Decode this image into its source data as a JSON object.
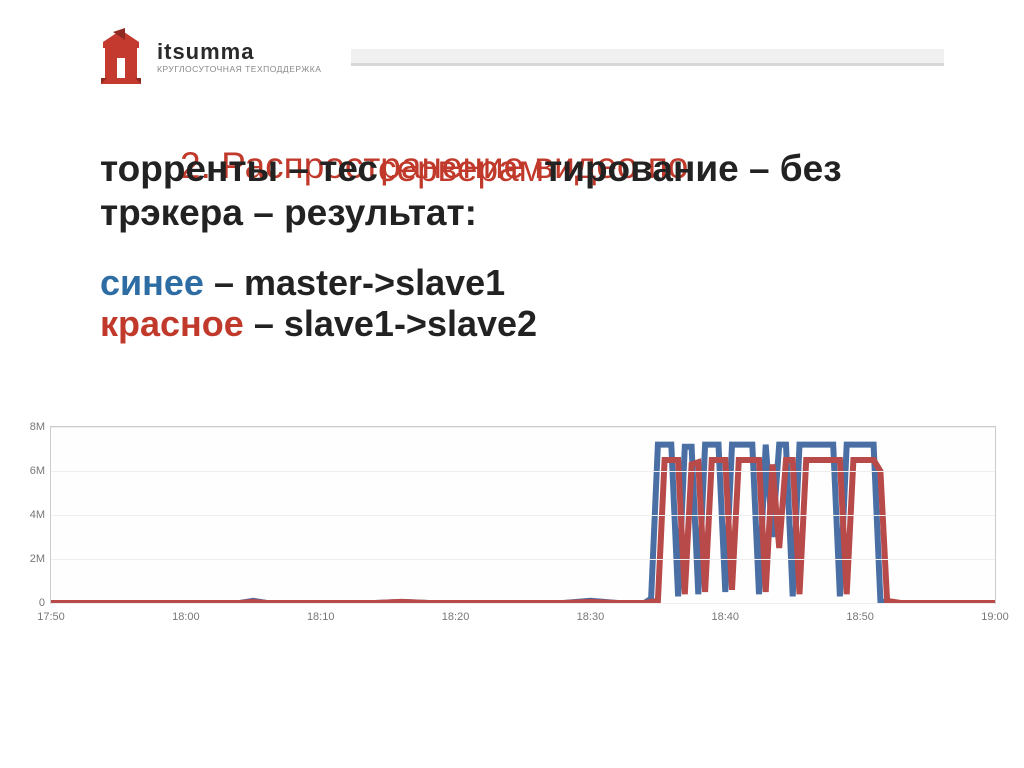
{
  "logo": {
    "brand": "itsumma",
    "sub": "КРУГЛОСУТОЧНАЯ ТЕХПОДДЕРЖКА"
  },
  "title_line1": "2. Распространение видео по",
  "title_mix_pre": "торренты – тес",
  "title_mix_red": "серверам",
  "title_mix_post": "тирование – без",
  "title_line2": "трэкера – результат:",
  "legend": {
    "blue_label": "синее",
    "blue_desc": " – master->slave1",
    "red_label": "красное",
    "red_desc": " – slave1->slave2"
  },
  "chart_data": {
    "type": "line",
    "title": "",
    "xlabel": "",
    "ylabel": "",
    "xlim": [
      "17:50",
      "19:00"
    ],
    "ylim": [
      0,
      8
    ],
    "y_unit": "M",
    "y_ticks": [
      0,
      2,
      4,
      6,
      8
    ],
    "y_tick_labels": [
      "0",
      "2M",
      "4M",
      "6M",
      "8M"
    ],
    "categories": [
      "17:50",
      "18:00",
      "18:10",
      "18:20",
      "18:30",
      "18:40",
      "18:50",
      "19:00"
    ],
    "x_minutes": [
      0,
      10,
      20,
      30,
      40,
      50,
      60,
      70
    ],
    "series": [
      {
        "name": "master->slave1",
        "color": "#4a6fa5",
        "points": [
          [
            0,
            0.0
          ],
          [
            1,
            0.0
          ],
          [
            2,
            0.0
          ],
          [
            3,
            0.0
          ],
          [
            4,
            0.0
          ],
          [
            5,
            0.0
          ],
          [
            6,
            0.0
          ],
          [
            7,
            0.0
          ],
          [
            8,
            0.0
          ],
          [
            9,
            0.0
          ],
          [
            10,
            0.0
          ],
          [
            12,
            0.0
          ],
          [
            14,
            0.0
          ],
          [
            15,
            0.1
          ],
          [
            16,
            0.0
          ],
          [
            18,
            0.0
          ],
          [
            20,
            0.0
          ],
          [
            22,
            0.0
          ],
          [
            24,
            0.0
          ],
          [
            26,
            0.05
          ],
          [
            28,
            0.0
          ],
          [
            30,
            0.0
          ],
          [
            32,
            0.0
          ],
          [
            34,
            0.0
          ],
          [
            36,
            0.0
          ],
          [
            38,
            0.0
          ],
          [
            40,
            0.1
          ],
          [
            42,
            0.0
          ],
          [
            43,
            0.0
          ],
          [
            44,
            0.0
          ],
          [
            44.5,
            0.2
          ],
          [
            45,
            7.2
          ],
          [
            45.5,
            7.2
          ],
          [
            46,
            7.2
          ],
          [
            46.5,
            0.3
          ],
          [
            47,
            7.1
          ],
          [
            47.5,
            7.1
          ],
          [
            48,
            0.4
          ],
          [
            48.5,
            7.2
          ],
          [
            49,
            7.2
          ],
          [
            49.5,
            7.2
          ],
          [
            50,
            0.5
          ],
          [
            50.5,
            7.2
          ],
          [
            51,
            7.2
          ],
          [
            51.5,
            7.2
          ],
          [
            52,
            7.2
          ],
          [
            52.5,
            0.4
          ],
          [
            53,
            7.2
          ],
          [
            53.5,
            3.0
          ],
          [
            54,
            7.2
          ],
          [
            54.5,
            7.2
          ],
          [
            55,
            0.3
          ],
          [
            55.5,
            7.2
          ],
          [
            56,
            7.2
          ],
          [
            56.5,
            7.2
          ],
          [
            57,
            7.2
          ],
          [
            57.5,
            7.2
          ],
          [
            58,
            7.2
          ],
          [
            58.5,
            0.3
          ],
          [
            59,
            7.2
          ],
          [
            59.5,
            7.2
          ],
          [
            60,
            7.2
          ],
          [
            60.5,
            7.2
          ],
          [
            61,
            7.2
          ],
          [
            61.5,
            0.1
          ],
          [
            62,
            0.0
          ],
          [
            63,
            0.0
          ],
          [
            64,
            0.0
          ],
          [
            66,
            0.0
          ],
          [
            68,
            0.0
          ],
          [
            70,
            0.0
          ]
        ]
      },
      {
        "name": "slave1->slave2",
        "color": "#b84a4a",
        "points": [
          [
            0,
            0.0
          ],
          [
            2,
            0.0
          ],
          [
            4,
            0.0
          ],
          [
            6,
            0.0
          ],
          [
            8,
            0.0
          ],
          [
            10,
            0.0
          ],
          [
            12,
            0.0
          ],
          [
            14,
            0.0
          ],
          [
            15,
            0.05
          ],
          [
            16,
            0.0
          ],
          [
            18,
            0.0
          ],
          [
            20,
            0.0
          ],
          [
            22,
            0.0
          ],
          [
            24,
            0.0
          ],
          [
            26,
            0.05
          ],
          [
            28,
            0.0
          ],
          [
            30,
            0.0
          ],
          [
            32,
            0.0
          ],
          [
            34,
            0.0
          ],
          [
            36,
            0.0
          ],
          [
            38,
            0.0
          ],
          [
            40,
            0.05
          ],
          [
            42,
            0.0
          ],
          [
            44,
            0.0
          ],
          [
            45,
            0.1
          ],
          [
            45.5,
            6.5
          ],
          [
            46,
            6.5
          ],
          [
            46.5,
            6.5
          ],
          [
            47,
            0.4
          ],
          [
            47.5,
            6.3
          ],
          [
            48,
            6.4
          ],
          [
            48.5,
            0.5
          ],
          [
            49,
            6.5
          ],
          [
            49.5,
            6.5
          ],
          [
            50,
            6.5
          ],
          [
            50.5,
            0.6
          ],
          [
            51,
            6.5
          ],
          [
            51.5,
            6.5
          ],
          [
            52,
            6.5
          ],
          [
            52.5,
            6.5
          ],
          [
            53,
            0.5
          ],
          [
            53.5,
            6.3
          ],
          [
            54,
            2.5
          ],
          [
            54.5,
            6.5
          ],
          [
            55,
            6.5
          ],
          [
            55.5,
            0.4
          ],
          [
            56,
            6.5
          ],
          [
            56.5,
            6.5
          ],
          [
            57,
            6.5
          ],
          [
            57.5,
            6.5
          ],
          [
            58,
            6.5
          ],
          [
            58.5,
            6.5
          ],
          [
            59,
            0.4
          ],
          [
            59.5,
            6.5
          ],
          [
            60,
            6.5
          ],
          [
            60.5,
            6.5
          ],
          [
            61,
            6.5
          ],
          [
            61.5,
            6.0
          ],
          [
            62,
            0.1
          ],
          [
            63,
            0.0
          ],
          [
            64,
            0.0
          ],
          [
            66,
            0.0
          ],
          [
            68,
            0.0
          ],
          [
            70,
            0.0
          ]
        ]
      }
    ]
  }
}
